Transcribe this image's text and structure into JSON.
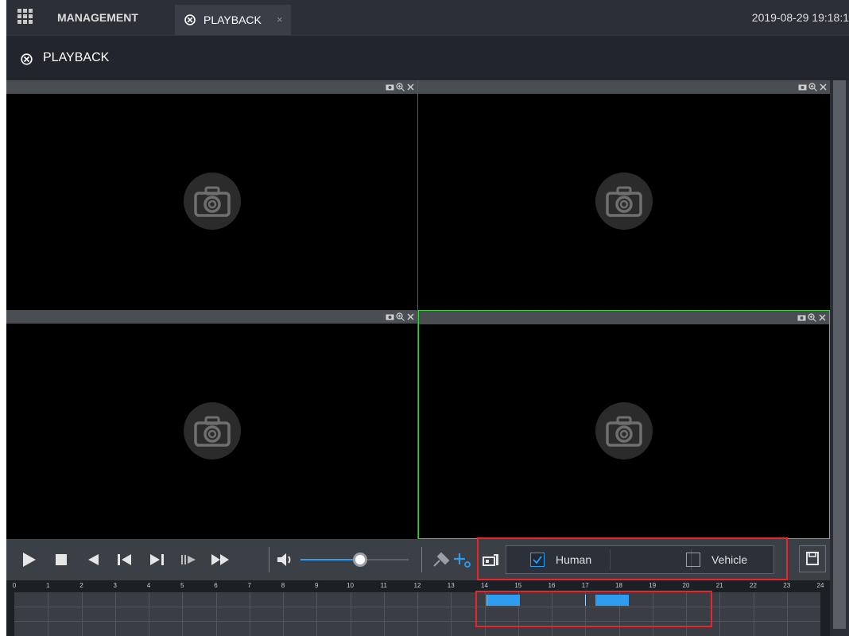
{
  "topbar": {
    "menu_icon": "grid-menu-icon",
    "management_label": "MANAGEMENT",
    "playback_tab_label": "PLAYBACK",
    "playback_tab_icon": "playback-icon",
    "close_glyph": "×",
    "datetime": "2019-08-29 19:18:1"
  },
  "page": {
    "title": "PLAYBACK",
    "title_icon": "playback-icon"
  },
  "video_panes": [
    {
      "id": "pane-1",
      "state": "no-video",
      "active": false,
      "tools": [
        "snapshot-icon",
        "zoom-in-icon",
        "close-icon"
      ]
    },
    {
      "id": "pane-2",
      "state": "no-video",
      "active": false,
      "tools": [
        "snapshot-icon",
        "zoom-in-icon",
        "close-icon"
      ]
    },
    {
      "id": "pane-3",
      "state": "no-video",
      "active": false,
      "tools": [
        "snapshot-icon",
        "zoom-in-icon",
        "close-icon"
      ]
    },
    {
      "id": "pane-4",
      "state": "no-video",
      "active": true,
      "tools": [
        "snapshot-icon",
        "zoom-in-icon",
        "close-icon"
      ]
    }
  ],
  "controls": {
    "buttons": [
      "play-icon",
      "stop-icon",
      "reverse-play-icon",
      "previous-frame-icon",
      "next-frame-icon",
      "slow-play-icon",
      "fast-forward-icon",
      "volume-icon",
      "tag-icon",
      "smart-search-icon",
      "intelligent-filter-icon",
      "save-clip-icon"
    ],
    "volume_level": 0.55
  },
  "filter_popup": {
    "options": [
      {
        "label": "Human",
        "checked": true
      },
      {
        "label": "Vehicle",
        "checked": false
      }
    ]
  },
  "timeline": {
    "hour_labels": [
      "0",
      "1",
      "2",
      "3",
      "4",
      "5",
      "6",
      "7",
      "8",
      "9",
      "10",
      "11",
      "12",
      "13",
      "14",
      "15",
      "16",
      "17",
      "18",
      "19",
      "20",
      "21",
      "22",
      "23",
      "24"
    ],
    "recordings": [
      {
        "start_hour": 14.05,
        "end_hour": 15.05
      },
      {
        "start_hour": 17.3,
        "end_hour": 18.3
      }
    ],
    "markers_hour": [
      14.05,
      17.0
    ]
  },
  "colors": {
    "accent_blue": "#2e9cf0",
    "active_pane_border": "#3ad13a",
    "highlight_red": "#e8242c"
  }
}
